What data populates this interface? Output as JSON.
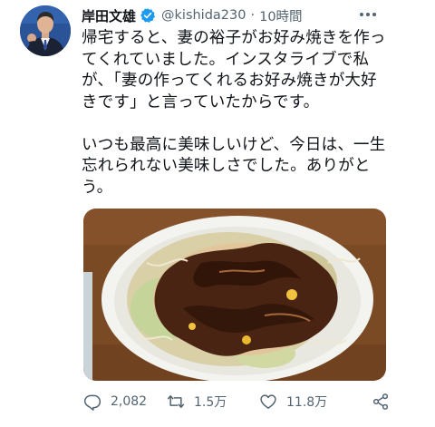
{
  "author": {
    "display_name": "岸田文雄",
    "handle": "@kishida230",
    "separator": "·",
    "time": "10時間"
  },
  "icons": {
    "verified": "verified-badge-icon",
    "more": "more-options-icon",
    "reply": "reply-icon",
    "retweet": "retweet-icon",
    "like": "like-icon",
    "share": "share-icon"
  },
  "tweet": {
    "paragraph_1_lines": [
      "帰宅すると、妻の裕子がお好み焼きを作っ",
      "てくれていました。インスタライブで私",
      "が、「妻の作ってくれるお好み焼きが大好",
      "きです」と言っていたからです。"
    ],
    "paragraph_2_lines": [
      "いつも最高に美味しいけど、今日は、一生",
      "忘れられない美味しさでした。ありがと",
      "う。"
    ]
  },
  "stats": {
    "replies": "2,082",
    "retweets": "1.5万",
    "likes": "11.8万"
  },
  "colors": {
    "text_primary": "#0f1419",
    "text_secondary": "#536471",
    "verified_blue": "#1d9bf0"
  }
}
